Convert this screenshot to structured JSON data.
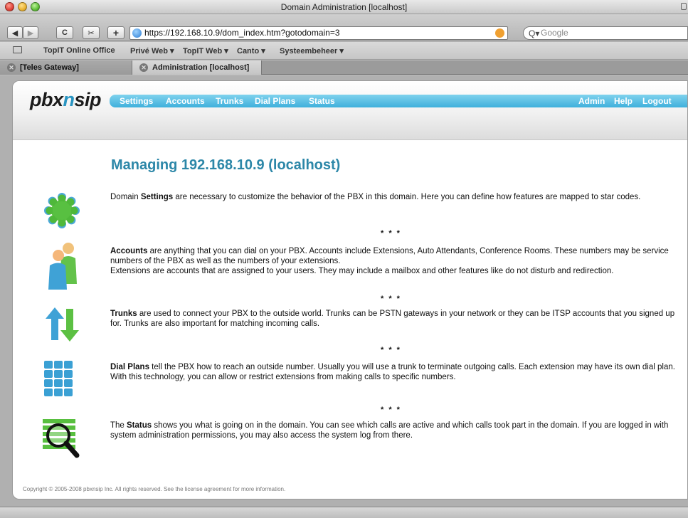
{
  "window": {
    "title": "Domain Administration [localhost]"
  },
  "toolbar": {
    "back_glyph": "◀",
    "forward_glyph": "▶",
    "reload_glyph": "C",
    "snap_glyph": "✂",
    "add_glyph": "+",
    "address_url": "https://192.168.10.9/dom_index.htm?gotodomain=3",
    "search_placeholder": "Google",
    "search_glyph": "Q▾"
  },
  "bookmarks": {
    "items": [
      {
        "label": "TopIT Online Office"
      },
      {
        "label": "Privé Web ▾"
      },
      {
        "label": "TopIT Web ▾"
      },
      {
        "label": "Canto ▾"
      },
      {
        "label": "Systeembeheer ▾"
      }
    ]
  },
  "tabs": [
    {
      "label": "[Teles Gateway]",
      "active": false
    },
    {
      "label": "Administration [localhost]",
      "active": true
    }
  ],
  "app": {
    "logo_prefix": "pbx",
    "logo_accent": "n",
    "logo_suffix": "sip",
    "accent_color": "#2a95c2",
    "nav_left": [
      {
        "label": "Settings"
      },
      {
        "label": "Accounts"
      },
      {
        "label": "Trunks"
      },
      {
        "label": "Dial Plans"
      },
      {
        "label": "Status"
      }
    ],
    "nav_right": [
      {
        "label": "Admin"
      },
      {
        "label": "Help"
      },
      {
        "label": "Logout"
      }
    ]
  },
  "main": {
    "title": "Managing 192.168.10.9 (localhost)",
    "separator": "* * *",
    "sections": [
      {
        "icon": "gear-icon",
        "lead_before": "Domain ",
        "keyword": "Settings",
        "text": " are necessary to customize the behavior of the PBX in this domain. Here you can define how features are mapped to star codes."
      },
      {
        "icon": "users-icon",
        "lead_before": "",
        "keyword": "Accounts",
        "text": " are anything that you can dial on your PBX. Accounts include Extensions, Auto Attendants, Conference Rooms. These numbers may be service numbers of the PBX as well as the numbers of your extensions.",
        "text2": "Extensions are accounts that are assigned to your users. They may include a mailbox and other features like do not disturb and redirection."
      },
      {
        "icon": "arrows-updown-icon",
        "lead_before": "",
        "keyword": "Trunks",
        "text": " are used to connect your PBX to the outside world. Trunks can be PSTN gateways in your network or they can be ITSP accounts that you signed up for. Trunks are also important for matching incoming calls."
      },
      {
        "icon": "keypad-icon",
        "lead_before": "",
        "keyword": "Dial Plans",
        "text": " tell the PBX how to reach an outside number. Usually you will use a trunk to terminate outgoing calls. Each extension may have its own dial plan. With this technology, you can allow or restrict extensions from making calls to specific numbers."
      },
      {
        "icon": "magnifier-icon",
        "lead_before": "The ",
        "keyword": "Status",
        "text": " shows you what is going on in the domain. You can see which calls are active and which calls took part in the domain. If you are logged in with system administration permissions, you may also access the system log from there."
      }
    ]
  },
  "footer": {
    "text": "Copyright © 2005-2008 pbxnsip Inc. All rights reserved. See the license agreement for more information."
  }
}
